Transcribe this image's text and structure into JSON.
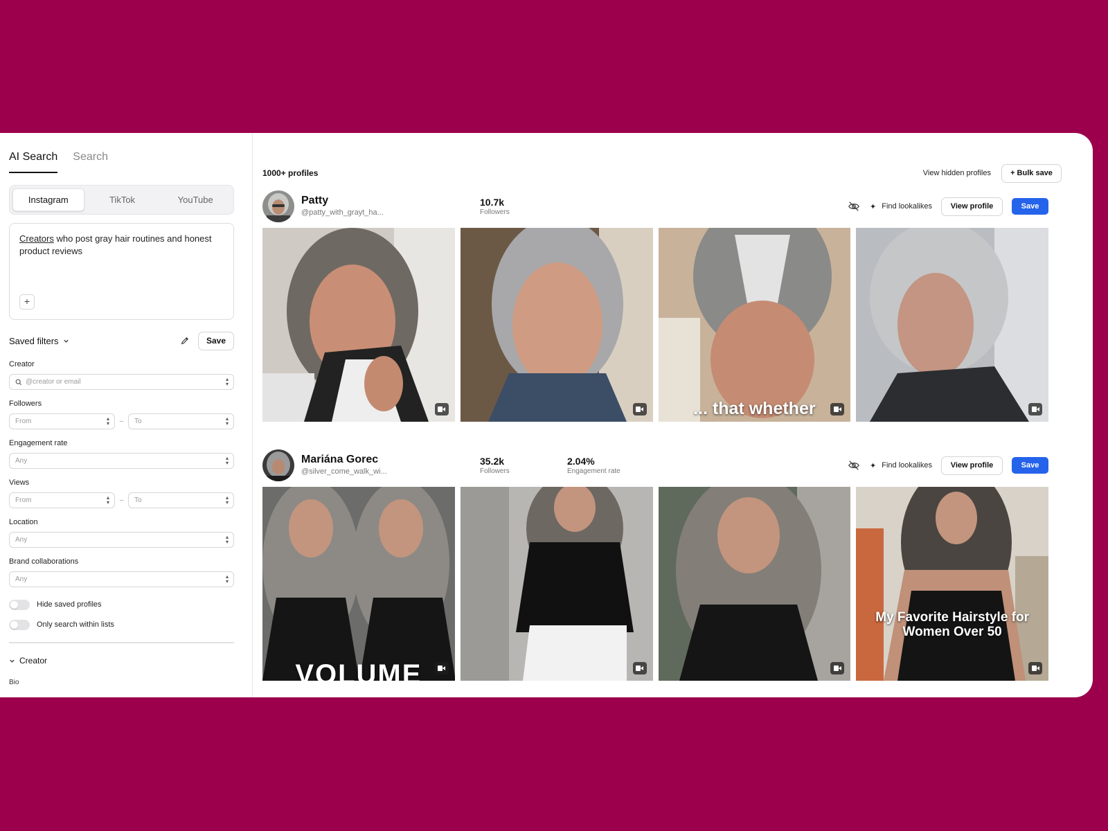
{
  "sidebar": {
    "mode_tabs": [
      "AI Search",
      "Search"
    ],
    "platform_tabs": [
      "Instagram",
      "TikTok",
      "YouTube"
    ],
    "prompt": {
      "first_word": "Creators",
      "rest": " who post gray hair routines and honest product reviews"
    },
    "plus_label": "+",
    "saved_filters_label": "Saved filters",
    "save_label": "Save",
    "creator": {
      "label": "Creator",
      "placeholder": "@creator or email"
    },
    "followers": {
      "label": "Followers",
      "from": "From",
      "to": "To"
    },
    "engagement": {
      "label": "Engagement rate",
      "value": "Any"
    },
    "views": {
      "label": "Views",
      "from": "From",
      "to": "To"
    },
    "location": {
      "label": "Location",
      "value": "Any"
    },
    "brand": {
      "label": "Brand collaborations",
      "value": "Any"
    },
    "toggles": {
      "hide_saved": "Hide saved profiles",
      "only_lists": "Only search within lists"
    },
    "section_creator": "Creator",
    "bio_label": "Bio",
    "range_dash": "–"
  },
  "main": {
    "profile_count": "1000+ profiles",
    "view_hidden": "View hidden profiles",
    "bulk_save": "+ Bulk save",
    "find_lookalikes": "Find lookalikes",
    "view_profile": "View profile",
    "save": "Save",
    "profiles": [
      {
        "name": "Patty",
        "handle": "@patty_with_grayt_ha...",
        "followers": "10.7k",
        "followers_label": "Followers",
        "thumb_text": "... that whether"
      },
      {
        "name": "Mariána Gorec",
        "handle": "@silver_come_walk_wi...",
        "followers": "35.2k",
        "followers_label": "Followers",
        "engagement": "2.04%",
        "engagement_label": "Engagement rate",
        "thumb_text_1": "VOLUME",
        "thumb_text_4": "My Favorite Hairstyle for Women Over 50"
      }
    ]
  },
  "colors": {
    "background": "#9c004d",
    "primary": "#2563eb"
  },
  "icons": [
    "search-icon",
    "pencil-icon",
    "chevron-down-icon",
    "eye-off-icon",
    "sparkle-icon",
    "video-icon",
    "plus-icon"
  ]
}
